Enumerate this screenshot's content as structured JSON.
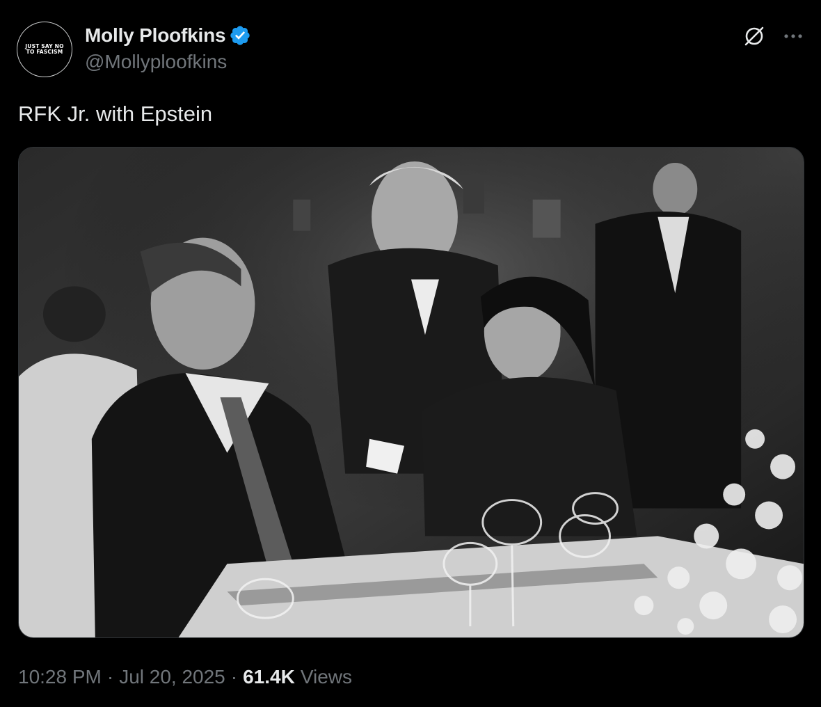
{
  "author": {
    "avatar_text": "JUST SAY NO\nTO FASCISM",
    "display_name": "Molly Ploofkins",
    "handle": "@Mollyploofkins",
    "verified": true,
    "verified_color": "#1d9bf0"
  },
  "header_icons": {
    "grok": "grok-icon",
    "more": "more-options-icon"
  },
  "tweet": {
    "text": "RFK Jr. with Epstein"
  },
  "media": {
    "type": "black-and-white photograph",
    "icon": "photo"
  },
  "meta": {
    "time": "10:28 PM",
    "separator": "·",
    "date": "Jul 20, 2025",
    "views_count": "61.4K",
    "views_label": "Views"
  },
  "colors": {
    "background": "#000000",
    "primary_text": "#e7e9ea",
    "secondary_text": "#71767b",
    "border": "#2f3336"
  }
}
